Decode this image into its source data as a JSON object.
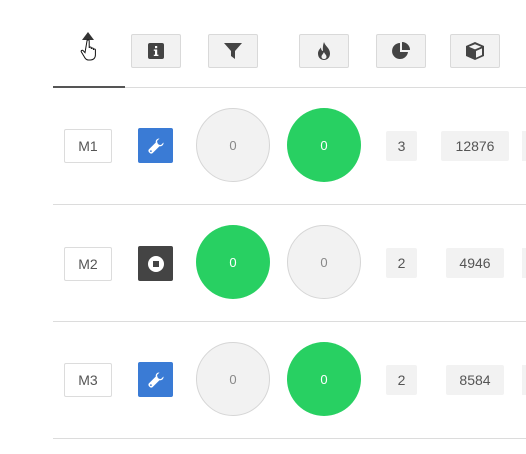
{
  "header": {
    "columns": [
      {
        "icon": "sort-up-icon"
      },
      {
        "icon": "info-icon"
      },
      {
        "icon": "filter-icon"
      },
      {
        "icon": "fire-icon"
      },
      {
        "icon": "pie-chart-icon"
      },
      {
        "icon": "cube-icon"
      }
    ]
  },
  "colors": {
    "green": "#28d062",
    "blue": "#3a7bd5",
    "dark": "#444444",
    "grey_bg": "#f2f2f2"
  },
  "rows": [
    {
      "machine": "M1",
      "status_icon": "wrench-icon",
      "circle_a": "0",
      "circle_a_on": false,
      "circle_b": "0",
      "circle_b_on": true,
      "count": "3",
      "total": "12876"
    },
    {
      "machine": "M2",
      "status_icon": "stop-icon",
      "circle_a": "0",
      "circle_a_on": true,
      "circle_b": "0",
      "circle_b_on": false,
      "count": "2",
      "total": "4946"
    },
    {
      "machine": "M3",
      "status_icon": "wrench-icon",
      "circle_a": "0",
      "circle_a_on": false,
      "circle_b": "0",
      "circle_b_on": true,
      "count": "2",
      "total": "8584"
    }
  ]
}
